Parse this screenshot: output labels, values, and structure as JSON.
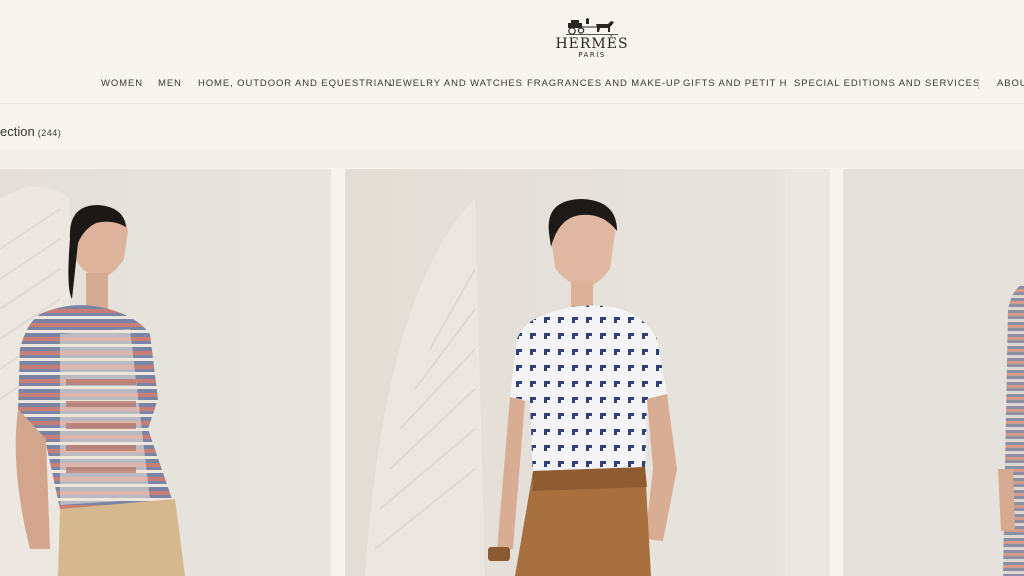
{
  "brand": {
    "name": "HERMÈS",
    "sub": "PARIS"
  },
  "nav": {
    "items": [
      "WOMEN",
      "MEN",
      "HOME, OUTDOOR AND EQUESTRIAN",
      "JEWELRY AND WATCHES",
      "FRAGRANCES AND MAKE-UP",
      "GIFTS AND PETIT H",
      "SPECIAL EDITIONS AND SERVICES",
      "ABOU"
    ]
  },
  "collection": {
    "title": "ection",
    "count": "(244)"
  },
  "products": [
    {
      "image": "model-patterned-tshirt-beige-pants"
    },
    {
      "image": "model-white-dotted-tshirt-brown-pants"
    },
    {
      "image": "model-striped-cardigan"
    }
  ],
  "colors": {
    "background": "#f8f5f0",
    "text": "#3b3633",
    "card_bg": "#e4e0da"
  }
}
